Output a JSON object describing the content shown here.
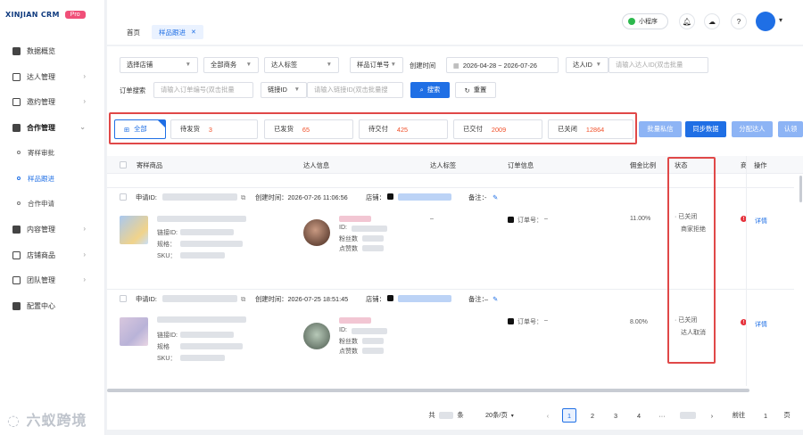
{
  "app": {
    "logo_text": "XINJIAN CRM",
    "badge": "Pro"
  },
  "sidebar": {
    "items": [
      {
        "label": "数据概览",
        "icon": "chart-icon"
      },
      {
        "label": "达人管理",
        "icon": "user-icon"
      },
      {
        "label": "邀约管理",
        "icon": "invite-icon"
      },
      {
        "label": "合作管理",
        "icon": "cooperation-icon"
      },
      {
        "label": "内容管理",
        "icon": "content-icon"
      },
      {
        "label": "店铺商品",
        "icon": "store-icon"
      },
      {
        "label": "团队管理",
        "icon": "team-icon"
      },
      {
        "label": "配置中心",
        "icon": "config-icon"
      }
    ],
    "sub_items": [
      "寄样审批",
      "样品跟进",
      "合作申请"
    ]
  },
  "header": {
    "tabs": [
      {
        "label": "首页"
      },
      {
        "label": "样品跟进"
      }
    ],
    "mini_program": "小程序"
  },
  "filters": {
    "store": "选择店铺",
    "products": "全部商务",
    "talent_tag": "达人标签",
    "sample_order": "样品订单号",
    "created_label": "创建时间",
    "date_range": "2026-04-28 ~ 2026-07-26",
    "talent_id": "达人ID",
    "talent_id_placeholder": "请输入达人ID(双击批量",
    "order_search_label": "订单搜索",
    "order_placeholder": "请输入订单编号(双击批量",
    "link_id": "链接ID",
    "link_placeholder": "请输入链接ID(双击批量搜",
    "search_btn": "搜索",
    "reset_btn": "重置"
  },
  "status_tabs": [
    {
      "label": "全部",
      "count": ""
    },
    {
      "label": "待发货",
      "count": "3"
    },
    {
      "label": "已发货",
      "count": "65"
    },
    {
      "label": "待交付",
      "count": "425"
    },
    {
      "label": "已交付",
      "count": "2009"
    },
    {
      "label": "已关闭",
      "count": "12864"
    }
  ],
  "actions": {
    "batch_msg": "批量私信",
    "sync": "同步数据",
    "assign": "分配达人",
    "more": "认领"
  },
  "table": {
    "headers": [
      "寄样商品",
      "达人信息",
      "达人标签",
      "订单信息",
      "佣金比例",
      "状态",
      "商",
      "操作"
    ],
    "rows": [
      {
        "apply_label": "申请ID:",
        "created": "创建时间：2026-07-26 11:06:56",
        "store_label": "店铺：",
        "note_label": "备注：",
        "note_value": "-",
        "link_label": "链接ID:",
        "spec_label": "规格：",
        "sku_label": "SKU：",
        "id_label": "ID:",
        "fans_label": "粉丝数",
        "likes_label": "点赞数",
        "tag": "–",
        "order_label": "订单号：",
        "order_value": "–",
        "commission": "11.00%",
        "status": "已关闭",
        "status_reason": "商家拒绝",
        "op": "详情"
      },
      {
        "apply_label": "申请ID:",
        "created": "创建时间：2026-07-25 18:51:45",
        "store_label": "店铺：",
        "note_label": "备注：",
        "note_value": "–",
        "link_label": "链接ID:",
        "spec_label": "规格",
        "sku_label": "SKU：",
        "id_label": "ID:",
        "fans_label": "粉丝数",
        "likes_label": "点赞数",
        "tag": "–",
        "order_label": "订单号：",
        "order_value": "–",
        "commission": "8.00%",
        "status": "已关闭",
        "status_reason": "达人取消",
        "op": "详情"
      }
    ]
  },
  "pagination": {
    "total_prefix": "共",
    "total_suffix": "条",
    "page_size": "20条/页",
    "pages": [
      "1",
      "2",
      "3",
      "4"
    ],
    "ellipsis": "···",
    "goto": "前往",
    "goto_value": "1",
    "page_suffix": "页"
  },
  "watermark": "六蚁跨境"
}
